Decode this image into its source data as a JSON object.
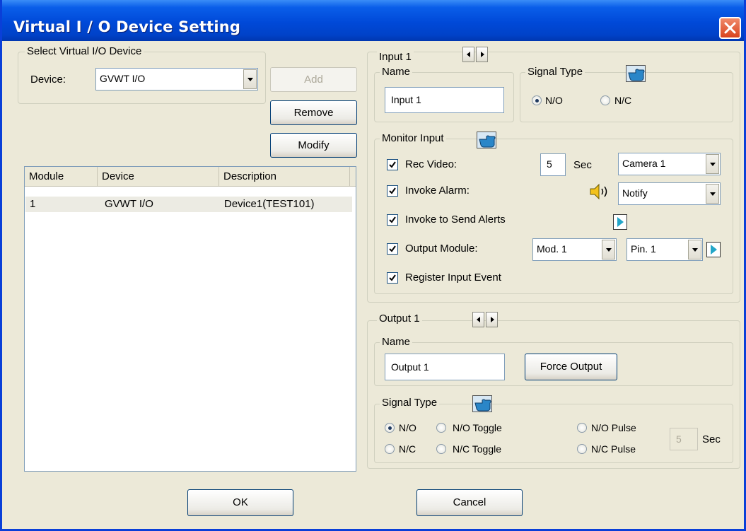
{
  "window": {
    "title": "Virtual I / O Device Setting"
  },
  "select_device": {
    "legend": "Select Virtual I/O Device",
    "device_label": "Device:",
    "device_value": "GVWT I/O"
  },
  "buttons": {
    "add": "Add",
    "remove": "Remove",
    "modify": "Modify",
    "ok": "OK",
    "cancel": "Cancel"
  },
  "device_list": {
    "columns": [
      "Module",
      "Device",
      "Description"
    ],
    "rows": [
      {
        "module": "1",
        "device": "GVWT I/O",
        "description": "Device1(TEST101)"
      }
    ]
  },
  "input": {
    "legend": "Input 1",
    "name_legend": "Name",
    "name_value": "Input 1",
    "signal_type_legend": "Signal Type",
    "signal_options": [
      "N/O",
      "N/C"
    ],
    "signal_selected": "N/O"
  },
  "monitor_input": {
    "legend": "Monitor Input",
    "rec_video_label": "Rec Video:",
    "rec_video_seconds": "5",
    "sec_label": "Sec",
    "camera_value": "Camera 1",
    "invoke_alarm_label": "Invoke Alarm:",
    "alarm_value": "Notify",
    "send_alerts_label": "Invoke to Send Alerts",
    "output_module_label": "Output Module:",
    "module_value": "Mod. 1",
    "pin_value": "Pin. 1",
    "register_event_label": "Register Input Event",
    "checked": {
      "rec_video": true,
      "invoke_alarm": true,
      "send_alerts": true,
      "output_module": true,
      "register_event": true
    }
  },
  "output": {
    "legend": "Output 1",
    "name_legend": "Name",
    "name_value": "Output 1",
    "force_output_label": "Force Output",
    "signal_type_legend": "Signal Type",
    "options": {
      "no": "N/O",
      "no_toggle": "N/O Toggle",
      "no_pulse": "N/O Pulse",
      "nc": "N/C",
      "nc_toggle": "N/C Toggle",
      "nc_pulse": "N/C Pulse"
    },
    "signal_selected": "N/O",
    "pulse_seconds": "5",
    "sec_label": "Sec"
  },
  "icons": {
    "close": "close-icon",
    "pointer": "pointing-hand-icon",
    "speaker": "speaker-icon",
    "play": "play-arrow-icon",
    "prev": "arrow-left-icon",
    "next": "arrow-right-icon"
  },
  "colors": {
    "titlebar": "#0049d8",
    "face": "#ece9d8",
    "close": "#d9431e",
    "accent_play": "#23a6c8"
  }
}
